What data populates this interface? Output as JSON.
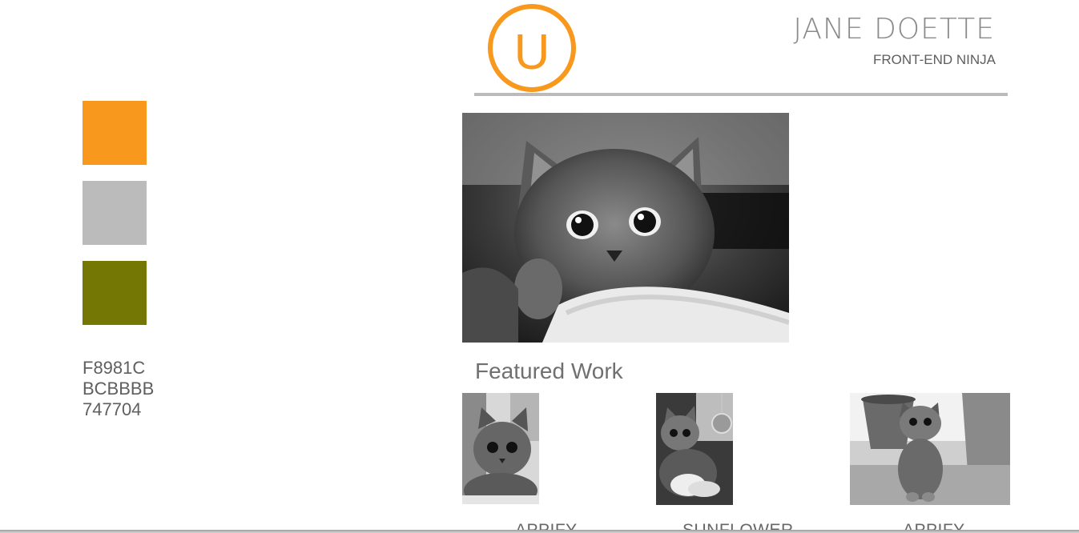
{
  "colors": {
    "orange": "#F8981C",
    "gray": "#BCBBBB",
    "olive": "#747704"
  },
  "palette": {
    "hex_codes": [
      "F8981C",
      "BCBBBB",
      "747704"
    ]
  },
  "header": {
    "logo_letter": "U",
    "name": "JANE DOETTE",
    "title": "FRONT-END NINJA"
  },
  "main": {
    "featured_heading": "Featured Work",
    "hero_icon": "kitten-photo",
    "works": [
      {
        "label": "APPIFY",
        "icon": "kitten-photo"
      },
      {
        "label": "SUNFLOWER",
        "icon": "kitten-photo"
      },
      {
        "label": "APPIFY",
        "icon": "kitten-photo"
      }
    ]
  }
}
